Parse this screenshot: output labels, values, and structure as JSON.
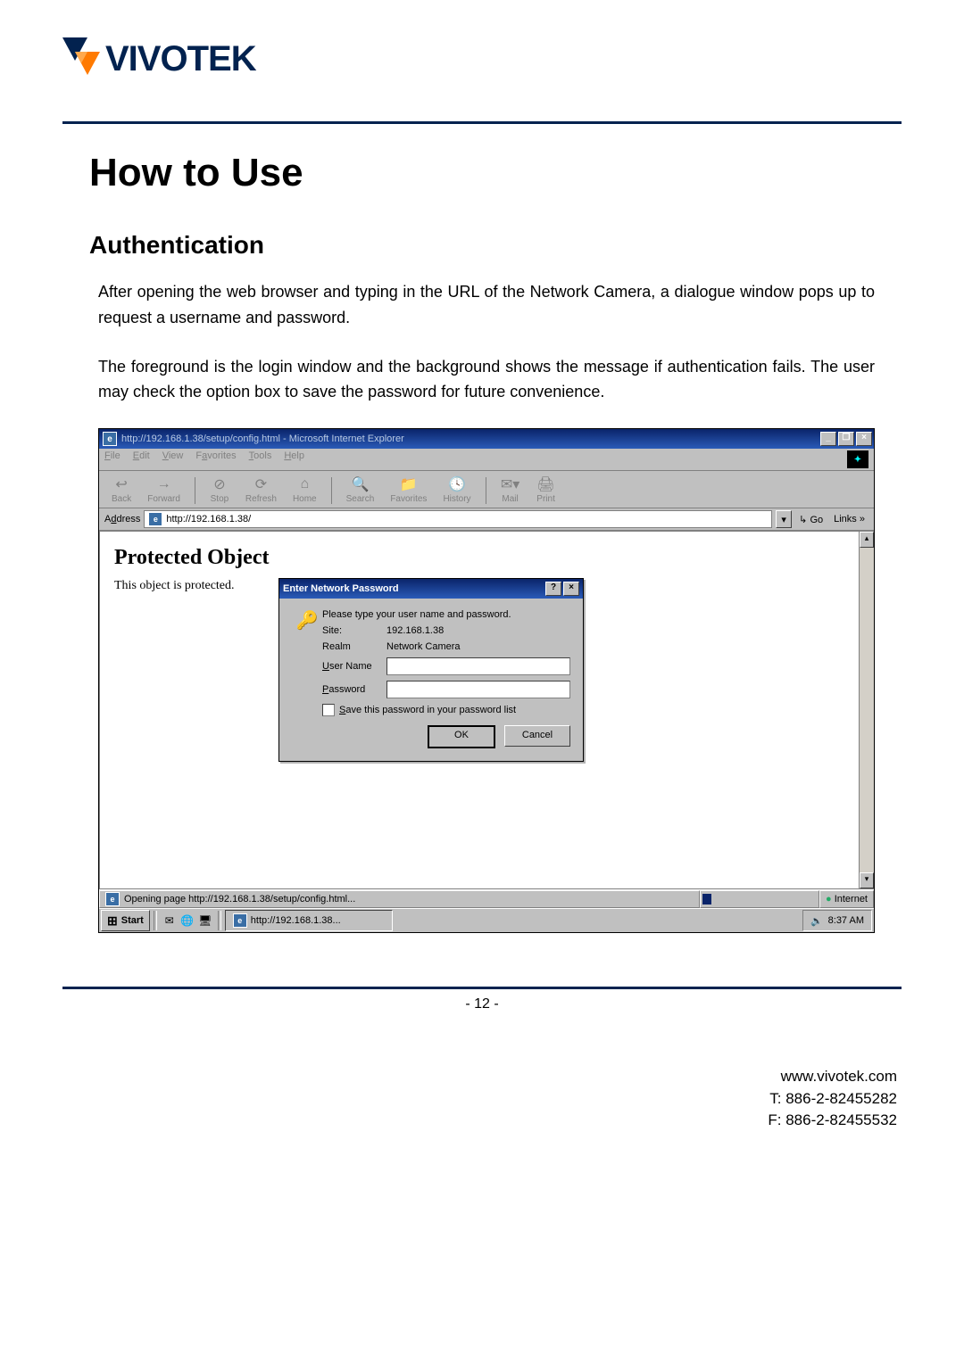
{
  "logo_text": "VIVOTEK",
  "heading": "How to Use",
  "subheading": "Authentication",
  "para1": "After opening the web browser and typing in the URL of the Network Camera, a dialogue window pops up to request a username and password.",
  "para2": "The foreground is the login window and the background shows the message if authentication fails. The user may check the option box to save the password for future convenience.",
  "ie": {
    "title_prefix": "http://192.168.1.38/setup/config.html - ",
    "title_app": "Microsoft Internet Explorer",
    "menus": {
      "file": "File",
      "edit": "Edit",
      "view": "View",
      "favorites": "Favorites",
      "tools": "Tools",
      "help": "Help"
    },
    "toolbar": {
      "back": "Back",
      "forward": "Forward",
      "stop": "Stop",
      "refresh": "Refresh",
      "home": "Home",
      "search": "Search",
      "fav": "Favorites",
      "history": "History",
      "mail": "Mail",
      "print": "Print"
    },
    "address_label": "Address",
    "address_value": "http://192.168.1.38/",
    "go_label": "Go",
    "links_label": "Links",
    "content_heading": "Protected Object",
    "content_text": "This object is protected.",
    "status_text": "Opening page http://192.168.1.38/setup/config.html...",
    "status_zone": "Internet"
  },
  "dialog": {
    "title": "Enter Network Password",
    "prompt": "Please type your user name and password.",
    "site_label": "Site:",
    "site_value": "192.168.1.38",
    "realm_label": "Realm",
    "realm_value": "Network Camera",
    "user_label": "User Name",
    "pass_label": "Password",
    "save_label": "Save this password in your password list",
    "ok": "OK",
    "cancel": "Cancel"
  },
  "taskbar": {
    "start": "Start",
    "task_label": "http://192.168.1.38...",
    "clock": "8:37 AM"
  },
  "page_number": "- 12 -",
  "contact": {
    "site": "www.vivotek.com",
    "tel": "T: 886-2-82455282",
    "fax": "F: 886-2-82455532"
  }
}
